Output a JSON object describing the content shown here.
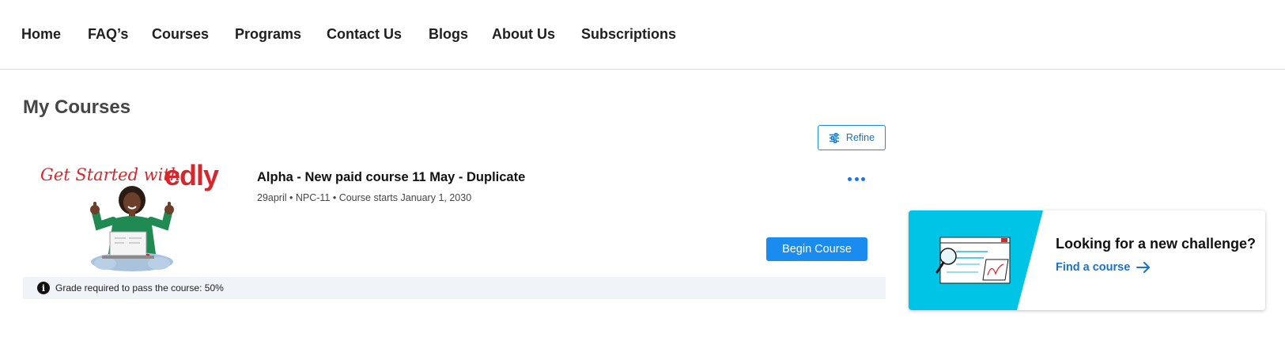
{
  "nav": {
    "items": [
      {
        "label": "Home"
      },
      {
        "label": "FAQ’s"
      },
      {
        "label": "Courses"
      },
      {
        "label": "Programs"
      },
      {
        "label": "Contact Us"
      },
      {
        "label": "Blogs"
      },
      {
        "label": "About Us"
      },
      {
        "label": "Subscriptions"
      }
    ]
  },
  "page": {
    "title": "My Courses"
  },
  "toolbar": {
    "refine_label": "Refine",
    "refine_icon": "sliders-icon"
  },
  "course": {
    "thumbnail": {
      "heading": "Get Started with",
      "brand": "edly"
    },
    "title": "Alpha - New paid course 11 May - Duplicate",
    "meta": "29april • NPC-11 • Course starts January 1, 2030",
    "action_label": "Begin Course",
    "menu_icon": "more-horizontal-icon",
    "grade_notice": "Grade required to pass the course: 50%"
  },
  "promo": {
    "title": "Looking for a new challenge?",
    "link_label": "Find a course",
    "accent_color": "#00c4e6"
  },
  "colors": {
    "primary": "#1a8cf0",
    "link": "#1a73c8",
    "brand_red": "#d7262c"
  }
}
